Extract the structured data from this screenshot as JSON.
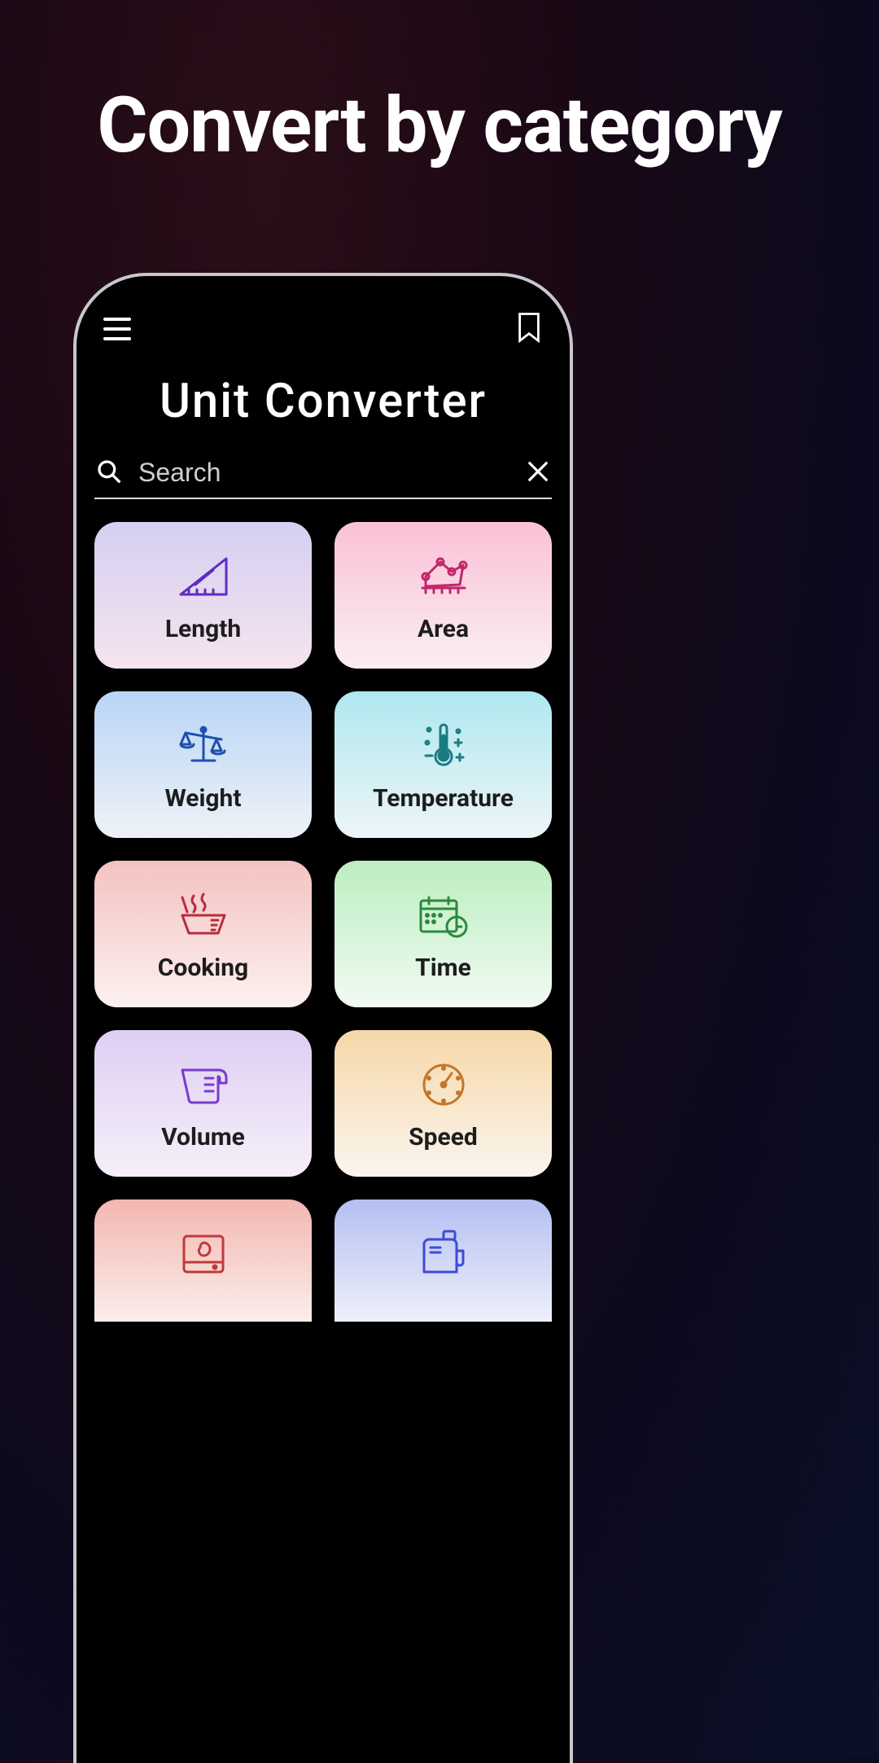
{
  "headline": "Convert by category",
  "appTitle": "Unit  Converter",
  "search": {
    "placeholder": "Search"
  },
  "categories": [
    {
      "label": "Length"
    },
    {
      "label": "Area"
    },
    {
      "label": "Weight"
    },
    {
      "label": "Temperature"
    },
    {
      "label": "Cooking"
    },
    {
      "label": "Time"
    },
    {
      "label": "Volume"
    },
    {
      "label": "Speed"
    }
  ]
}
